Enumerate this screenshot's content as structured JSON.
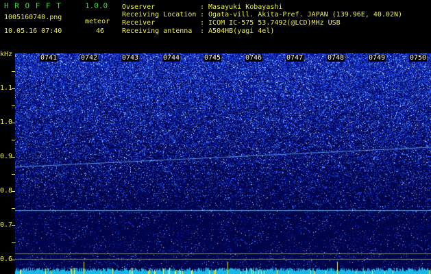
{
  "header": {
    "app_name": "H R O F F T",
    "version": "1.0.0",
    "filename": "1005160740.png",
    "date_time": "10.05.16 07:40",
    "meteor_label": "meteor",
    "meteor_count": "46"
  },
  "station_info": [
    {
      "key": "Ovserver",
      "value": ": Masayuki Kobayashi"
    },
    {
      "key": "Receiving Location",
      "value": ": Ogata-vill. Akita-Pref. JAPAN (139.96E, 40.02N)"
    },
    {
      "key": "Receiver",
      "value": ": ICOM IC-575 53.7492(@LCD)MHz USB"
    },
    {
      "key": "Receiving antenna",
      "value": ": A504HB(yagi 4el)"
    }
  ],
  "spectrogram": {
    "y_unit": "kHz",
    "y_ticks": [
      "1.1",
      "1.0",
      "0.9",
      "0.8",
      "0.7",
      "0.6"
    ],
    "time_labels": [
      "0741",
      "0742",
      "0743",
      "0744",
      "0745",
      "0746",
      "0747",
      "0748",
      "0749",
      "0750"
    ],
    "colors": {
      "low": "#000a5a",
      "mid": "#1e3cff",
      "high": "#c8e6ff",
      "signal": "#3cc8ff",
      "level": "#00e0ff",
      "peak": "#f0f03c"
    }
  }
}
